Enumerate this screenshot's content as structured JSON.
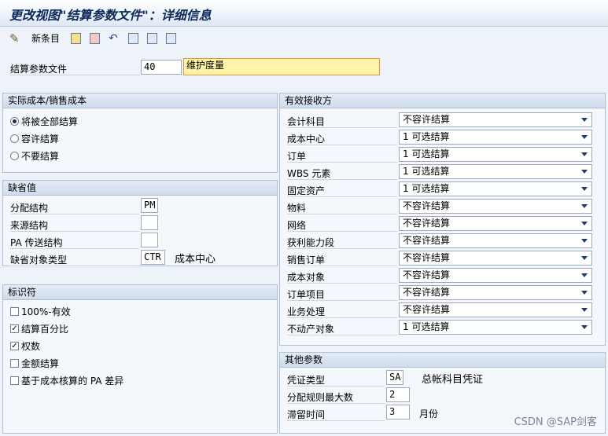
{
  "window": {
    "title": "更改视图\"结算参数文件\"：详细信息"
  },
  "toolbar": {
    "new_entries_label": "新条目"
  },
  "profile": {
    "label": "结算参数文件",
    "code": "40",
    "description": "维护度量"
  },
  "actual_cost": {
    "title": "实际成本/销售成本",
    "options": [
      {
        "label": "将被全部结算",
        "selected": true
      },
      {
        "label": "容许结算",
        "selected": false
      },
      {
        "label": "不要结算",
        "selected": false
      }
    ]
  },
  "defaults": {
    "title": "缺省值",
    "rows": [
      {
        "label": "分配结构",
        "value": "PM",
        "desc": ""
      },
      {
        "label": "来源结构",
        "value": "",
        "desc": ""
      },
      {
        "label": "PA 传送结构",
        "value": "",
        "desc": ""
      },
      {
        "label": "缺省对象类型",
        "value": "CTR",
        "desc": "成本中心"
      }
    ]
  },
  "indicators": {
    "title": "标识符",
    "items": [
      {
        "label": "100%-有效",
        "checked": false
      },
      {
        "label": "结算百分比",
        "checked": true
      },
      {
        "label": "权数",
        "checked": true
      },
      {
        "label": "金额结算",
        "checked": false
      },
      {
        "label": "基于成本核算的 PA 差异",
        "checked": false
      }
    ]
  },
  "receivers": {
    "title": "有效接收方",
    "rows": [
      {
        "label": "会计科目",
        "value": "不容许结算"
      },
      {
        "label": "成本中心",
        "value": "1 可选结算"
      },
      {
        "label": "订单",
        "value": "1 可选结算"
      },
      {
        "label": "WBS 元素",
        "value": "1 可选结算"
      },
      {
        "label": "固定资产",
        "value": "1 可选结算"
      },
      {
        "label": "物料",
        "value": "不容许结算"
      },
      {
        "label": "网络",
        "value": "不容许结算"
      },
      {
        "label": "获利能力段",
        "value": "不容许结算"
      },
      {
        "label": "销售订单",
        "value": "不容许结算"
      },
      {
        "label": "成本对象",
        "value": "不容许结算"
      },
      {
        "label": "订单项目",
        "value": "不容许结算"
      },
      {
        "label": "业务处理",
        "value": "不容许结算"
      },
      {
        "label": "不动产对象",
        "value": "1 可选结算"
      }
    ]
  },
  "other": {
    "title": "其他参数",
    "rows": [
      {
        "label": "凭证类型",
        "value": "SA",
        "desc": "总帐科目凭证"
      },
      {
        "label": "分配规则最大数",
        "value": "2",
        "desc": ""
      },
      {
        "label": "滞留时间",
        "value": "3",
        "desc": "月份"
      }
    ]
  },
  "watermark": "CSDN @SAP剑客"
}
